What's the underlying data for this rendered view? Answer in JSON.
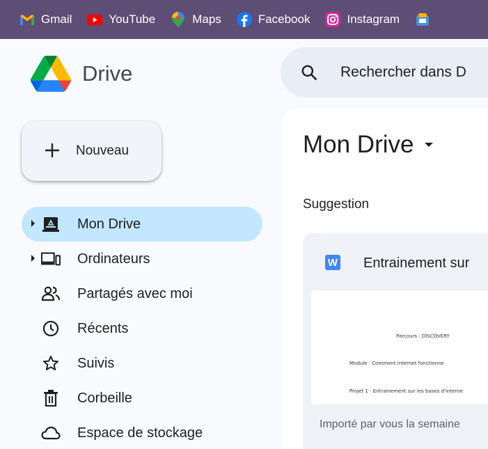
{
  "bookmarks": [
    {
      "label": "Gmail",
      "icon": "gmail-icon"
    },
    {
      "label": "YouTube",
      "icon": "youtube-icon"
    },
    {
      "label": "Maps",
      "icon": "maps-icon"
    },
    {
      "label": "Facebook",
      "icon": "facebook-icon"
    },
    {
      "label": "Instagram",
      "icon": "instagram-icon"
    }
  ],
  "logo": {
    "name": "Drive",
    "icon": "drive-logo-icon"
  },
  "search": {
    "placeholder": "Rechercher dans D",
    "icon": "search-icon"
  },
  "new_button": {
    "label": "Nouveau",
    "icon": "plus-icon"
  },
  "nav": {
    "items": [
      {
        "label": "Mon Drive",
        "icon": "my-drive-icon",
        "active": true
      },
      {
        "label": "Ordinateurs",
        "icon": "computers-icon"
      },
      {
        "label": "Partagés avec moi",
        "icon": "shared-icon"
      },
      {
        "label": "Récents",
        "icon": "clock-icon"
      },
      {
        "label": "Suivis",
        "icon": "star-icon"
      },
      {
        "label": "Corbeille",
        "icon": "trash-icon"
      },
      {
        "label": "Espace de stockage",
        "icon": "cloud-icon"
      }
    ]
  },
  "main": {
    "title": "Mon Drive",
    "section_label": "Suggestion",
    "card": {
      "title": "Entrainement sur",
      "icon_letter": "W",
      "preview_lines": [
        "Parcours : DISCOVERY",
        "Module : Comment internet fonctionne",
        "Projet 1 - Entrainement sur les bases d'interne"
      ],
      "footer": "Importé par vous la semaine"
    }
  },
  "colors": {
    "bookmarks_bg": "#5e4d74",
    "active_nav": "#c2e7ff",
    "search_bg": "#e9eef6",
    "word_blue": "#4285f4"
  }
}
